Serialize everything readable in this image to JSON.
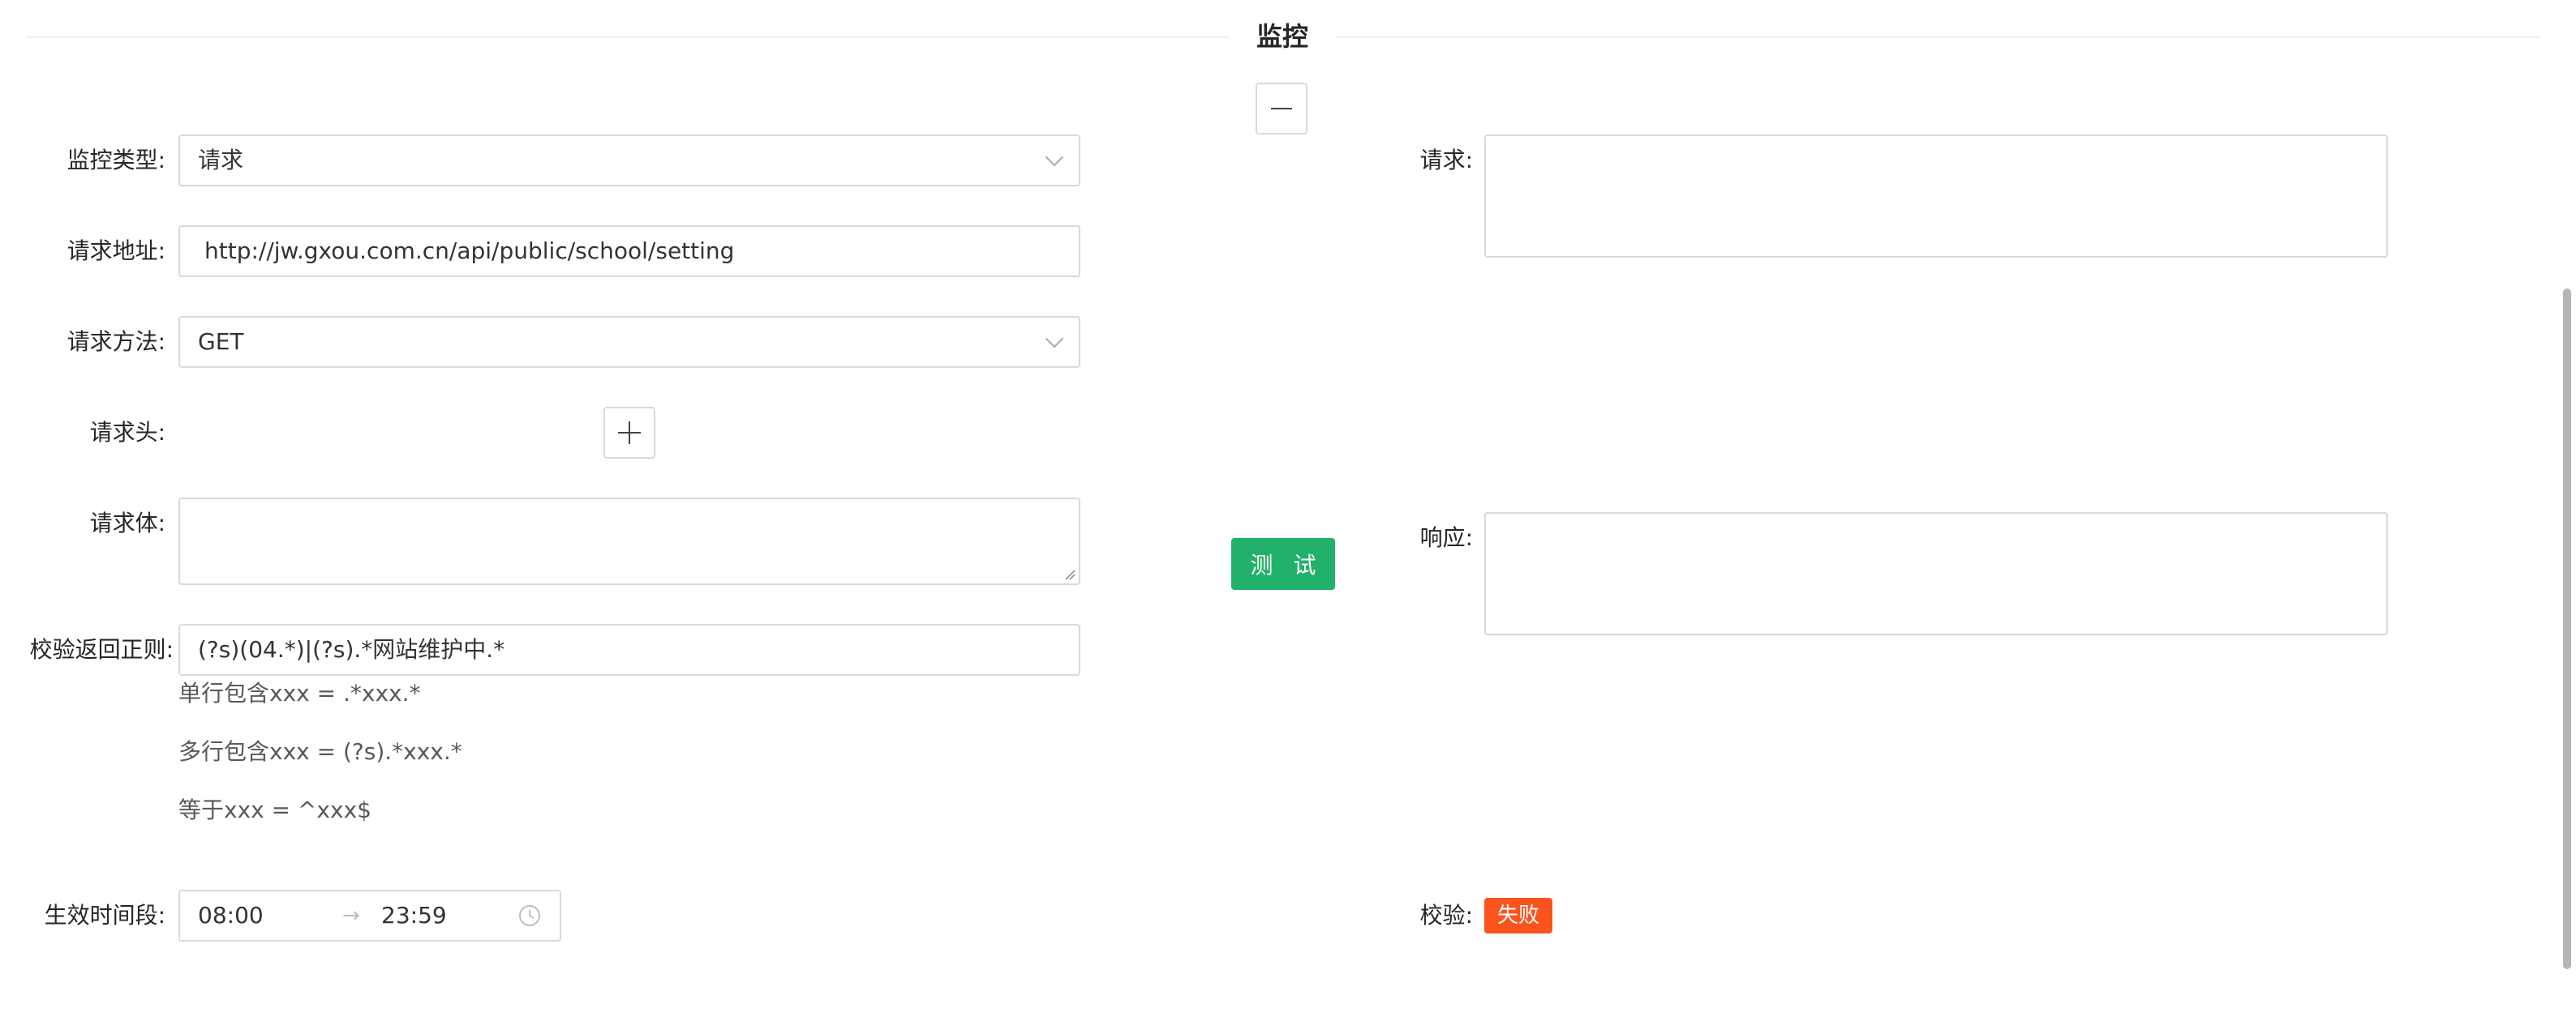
{
  "section": {
    "title": "监控"
  },
  "form": {
    "monitor_type": {
      "label": "监控类型:",
      "value": "请求"
    },
    "request_url": {
      "label": "请求地址:",
      "value": "http://jw.gxou.com.cn/api/public/school/setting"
    },
    "request_method": {
      "label": "请求方法:",
      "value": "GET"
    },
    "request_headers": {
      "label": "请求头:"
    },
    "request_body": {
      "label": "请求体:",
      "value": ""
    },
    "regex": {
      "label": "校验返回正则:",
      "value": "(?s)(04.*)|(?s).*网站维护中.*",
      "hints": [
        "单行包含xxx = .*xxx.*",
        "多行包含xxx = (?s).*xxx.*",
        "等于xxx = ^xxx$"
      ]
    },
    "time_range": {
      "label": "生效时间段:",
      "start": "08:00",
      "end": "23:59",
      "separator": "→"
    }
  },
  "test": {
    "button_label": "测 试"
  },
  "result": {
    "request": {
      "label": "请求:",
      "value": ""
    },
    "response": {
      "label": "响应:",
      "value": ""
    },
    "check": {
      "label": "校验:",
      "status": "失败"
    }
  },
  "colors": {
    "accent_green": "#21b16a",
    "status_fail": "#fa541c",
    "border": "#d9d9d9"
  },
  "icons": {
    "remove": "minus-icon",
    "add": "plus-icon",
    "select_arrow": "chevron-down-icon",
    "time": "clock-icon"
  }
}
